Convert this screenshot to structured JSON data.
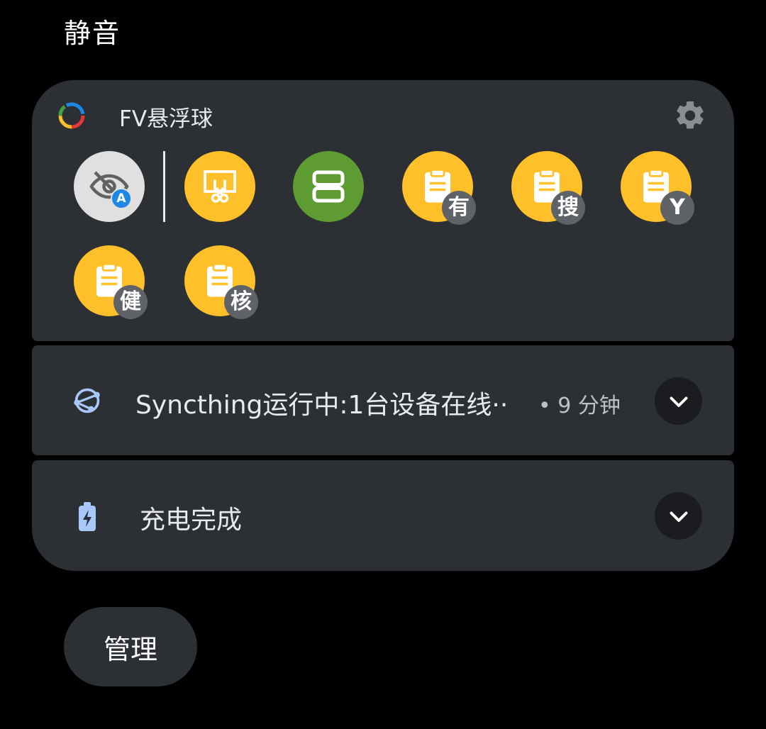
{
  "section": {
    "title": "静音"
  },
  "fv_card": {
    "app_name": "FV悬浮球",
    "app_icon": "fv-ring-icon",
    "settings_icon": "gear-icon",
    "bubbles": [
      {
        "icon": "eye-off-auto-icon",
        "badge": "A",
        "color": "#e0e0e0"
      },
      {
        "icon": "screenshot-scissor-icon",
        "badge": "",
        "color": "#ffc02a"
      },
      {
        "icon": "split-window-icon",
        "badge": "",
        "color": "#5e9b32"
      },
      {
        "icon": "clipboard-icon",
        "badge": "有",
        "color": "#ffc02a"
      },
      {
        "icon": "clipboard-icon",
        "badge": "搜",
        "color": "#ffc02a"
      },
      {
        "icon": "clipboard-icon",
        "badge": "Y",
        "color": "#ffc02a"
      },
      {
        "icon": "clipboard-icon",
        "badge": "健",
        "color": "#ffc02a"
      },
      {
        "icon": "clipboard-icon",
        "badge": "核",
        "color": "#ffc02a"
      }
    ]
  },
  "sync_card": {
    "icon": "syncthing-icon",
    "text": "Syncthing运行中:1台设备在线··",
    "time": "• 9 分钟",
    "expand_icon": "chevron-down-icon"
  },
  "charge_card": {
    "icon": "battery-charging-icon",
    "text": "充电完成",
    "expand_icon": "chevron-down-icon"
  },
  "footer": {
    "manage_label": "管理"
  }
}
